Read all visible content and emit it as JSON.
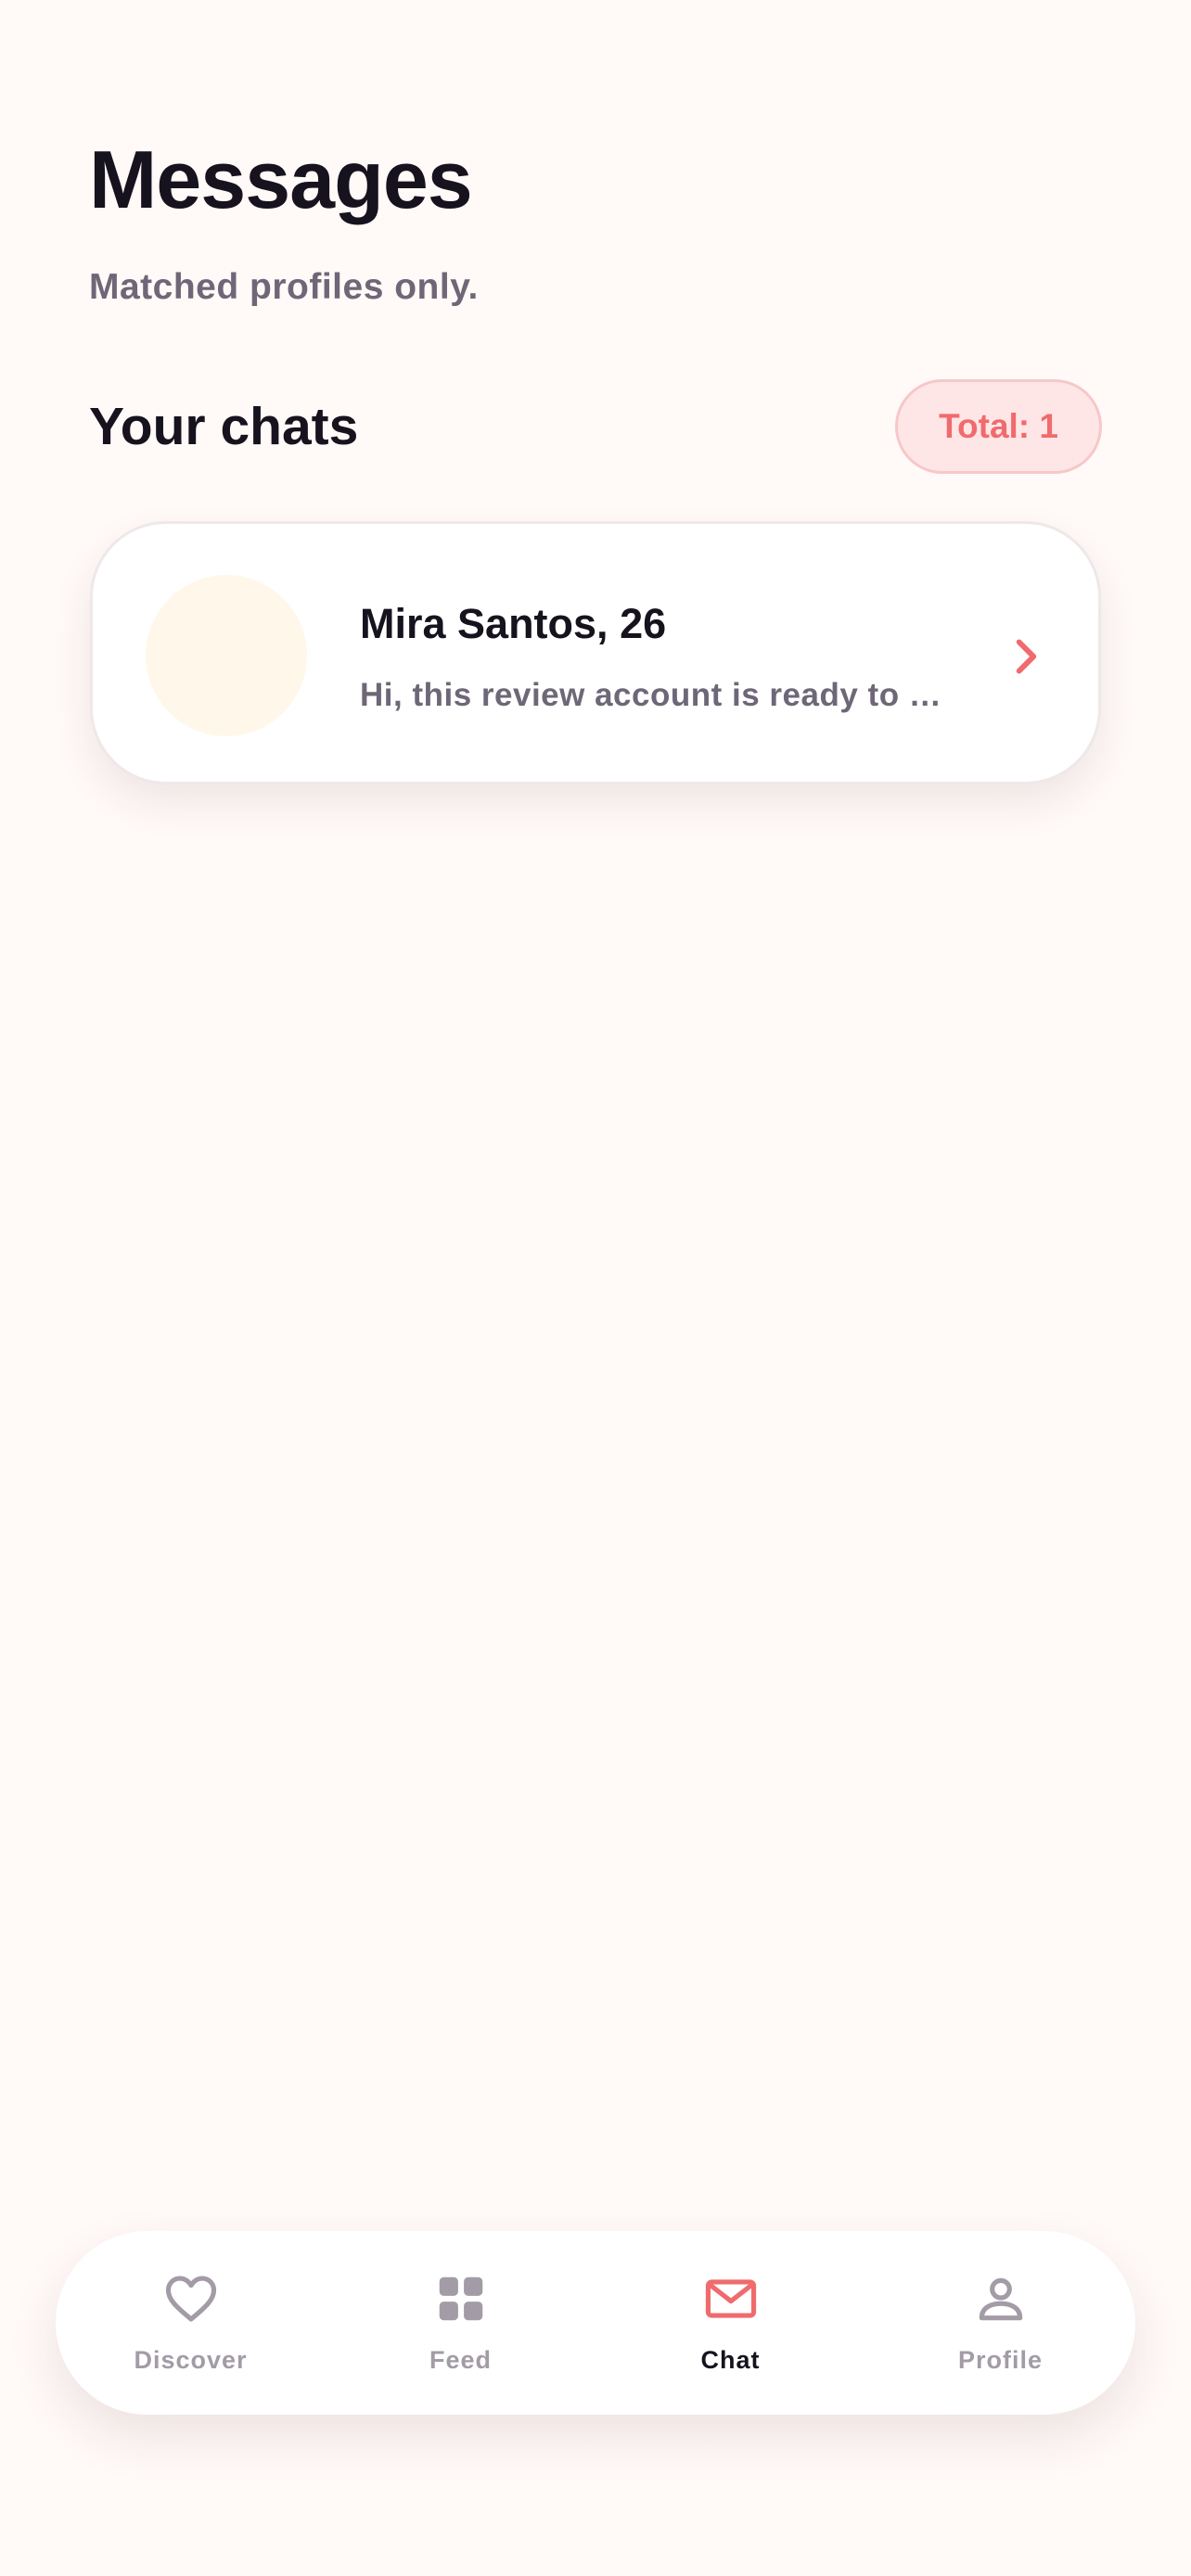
{
  "header": {
    "title": "Messages",
    "subtitle": "Matched profiles only."
  },
  "chats_section": {
    "title": "Your chats",
    "total_badge": "Total: 1"
  },
  "chats": [
    {
      "name": "Mira Santos, 26",
      "preview": "Hi, this review account is ready to …",
      "avatar_color": "#FFF8EA",
      "chevron_icon": "chevron-right-icon"
    }
  ],
  "bottom_nav": {
    "items": [
      {
        "label": "Discover",
        "icon": "heart-icon",
        "active": false
      },
      {
        "label": "Feed",
        "icon": "grid-icon",
        "active": false
      },
      {
        "label": "Chat",
        "icon": "mail-icon",
        "active": true
      },
      {
        "label": "Profile",
        "icon": "user-icon",
        "active": false
      }
    ]
  },
  "colors": {
    "background": "#FFF9F7",
    "accent": "#F06B6D",
    "badge_background": "#FFE6E6",
    "text_primary": "#16131E",
    "text_secondary": "#6E6777",
    "nav_inactive": "#A39BA6"
  }
}
